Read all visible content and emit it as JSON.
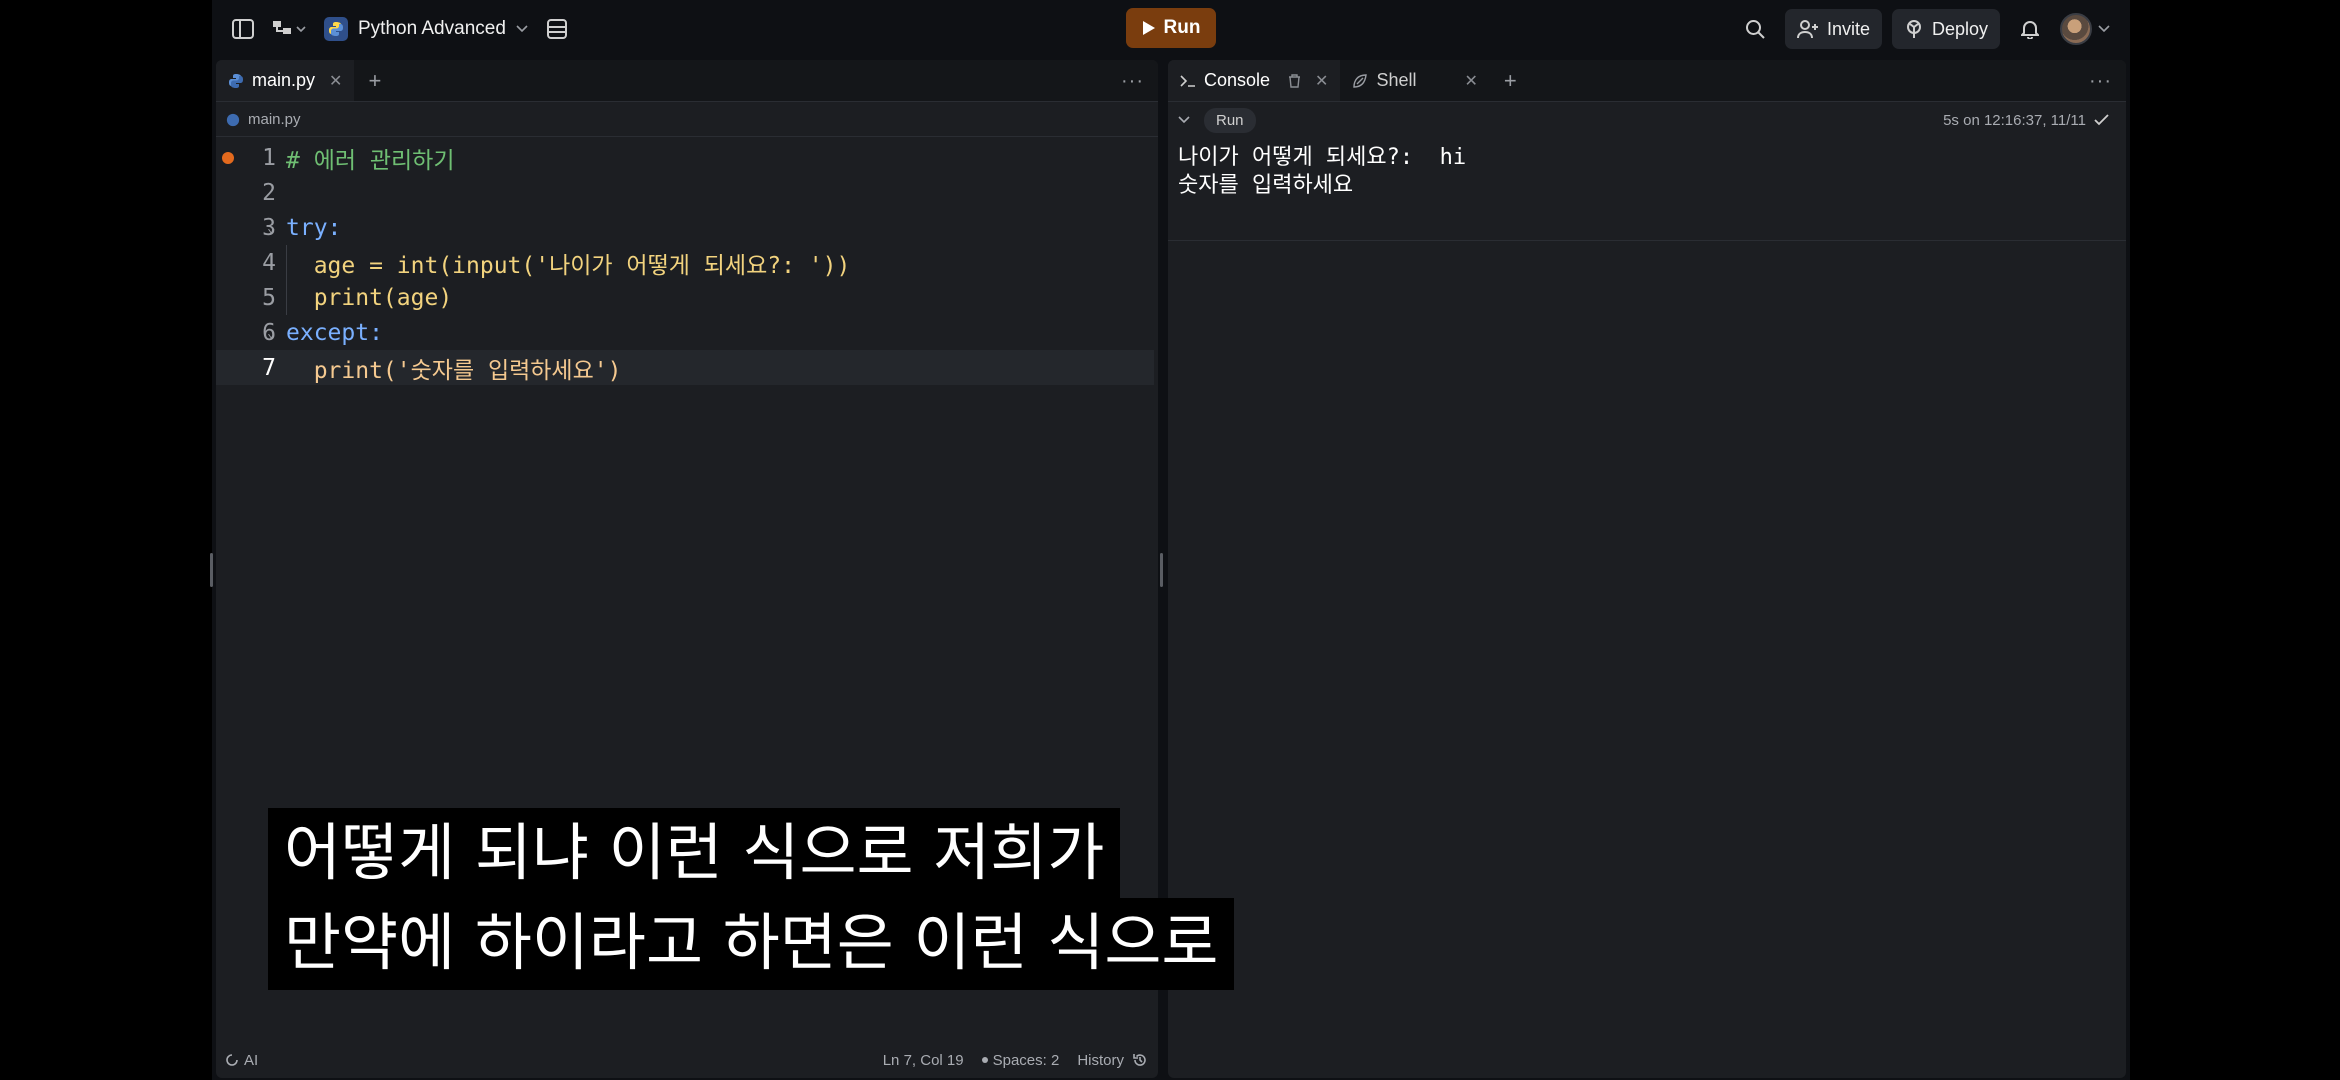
{
  "topbar": {
    "project_name": "Python Advanced",
    "run_label": "Run",
    "invite_label": "Invite",
    "deploy_label": "Deploy"
  },
  "editor": {
    "tab_label": "main.py",
    "breadcrumb": "main.py",
    "lines": [
      {
        "num": "1",
        "text": "# 에러 관리하기"
      },
      {
        "num": "2",
        "text": ""
      },
      {
        "num": "3",
        "text": "try:"
      },
      {
        "num": "4",
        "text": "  age = int(input('나이가 어떻게 되세요?: '))"
      },
      {
        "num": "5",
        "text": "  print(age)"
      },
      {
        "num": "6",
        "text": "except:"
      },
      {
        "num": "7",
        "text": "  print('숫자를 입력하세요')"
      }
    ],
    "status": {
      "ai_label": "AI",
      "cursor": "Ln 7, Col 19",
      "spaces": "Spaces: 2",
      "history": "History"
    }
  },
  "console": {
    "tab_console": "Console",
    "tab_shell": "Shell",
    "run_chip": "Run",
    "run_meta": "5s on 12:16:37, 11/11",
    "output": [
      "나이가 어떻게 되세요?:  hi",
      "숫자를 입력하세요"
    ]
  },
  "subtitle": {
    "line1": "어떻게 되냐 이런 식으로 저희가",
    "line2": "만약에 하이라고 하면은 이런 식으로"
  },
  "colors": {
    "run_button": "#7a3d0e",
    "breakpoint": "#e36a1e",
    "keyword": "#7ab0ff",
    "string": "#f5c990",
    "comment": "#6fbf73"
  }
}
